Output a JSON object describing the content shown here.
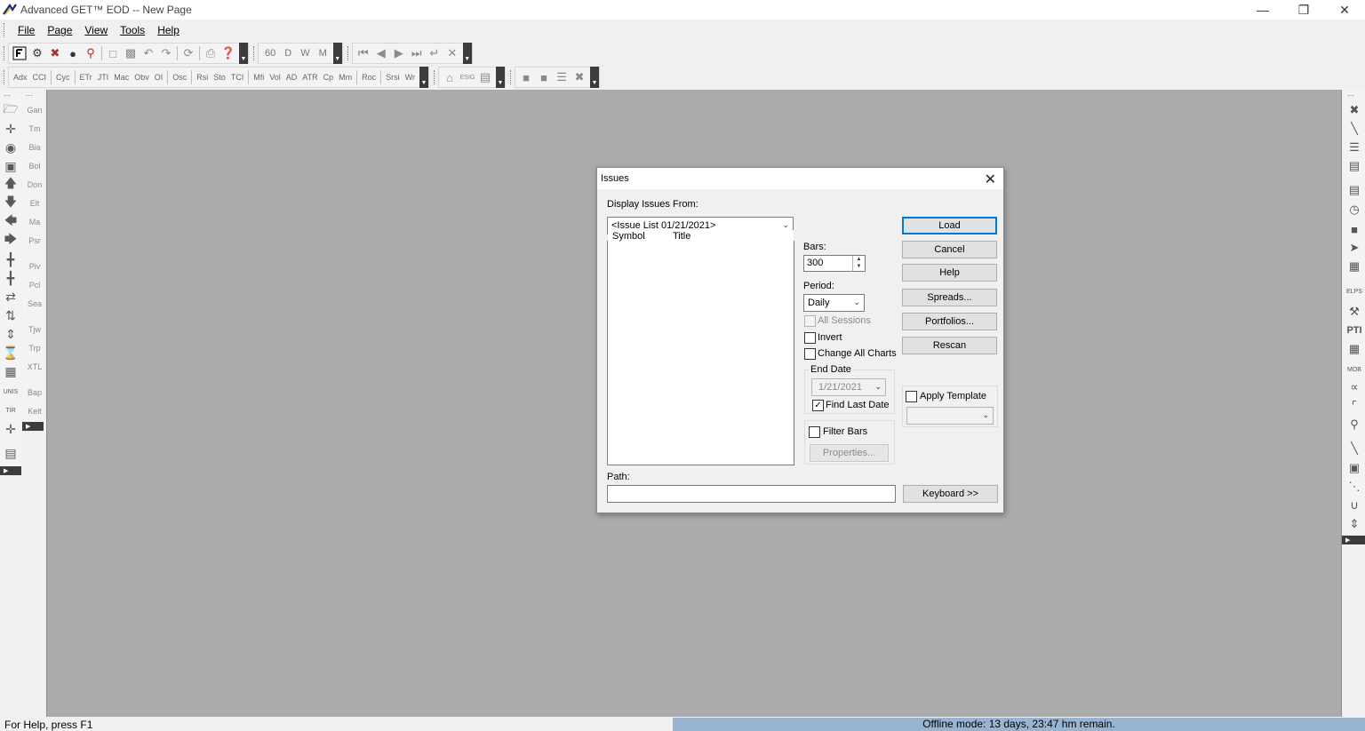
{
  "window": {
    "title": "Advanced GET™ EOD  --  New Page",
    "minimize": "—",
    "restore": "❐",
    "close": "✕"
  },
  "menu": {
    "file": "File",
    "page": "Page",
    "view": "View",
    "tools": "Tools",
    "help": "Help"
  },
  "toolbar1": {
    "period_60": "60",
    "period_d": "D",
    "period_w": "W",
    "period_m": "M"
  },
  "toolbar2": {
    "indicators": [
      "Adx",
      "CCI",
      "Cyc",
      "ETr",
      "JTI",
      "Mac",
      "Obv",
      "OI",
      "Osc",
      "Rsi",
      "Sto",
      "TCI",
      "Mfi",
      "Vol",
      "AD",
      "ATR",
      "Cp",
      "Mm",
      "Roc",
      "Srsi",
      "Wr"
    ],
    "esig_label": "ESIG"
  },
  "left_panel": {
    "labels": [
      "Gan",
      "Tm",
      "Bia",
      "Bol",
      "Don",
      "Elt",
      "Ma",
      "Psr",
      "Piv",
      "Pcl",
      "Sea",
      "Tjw",
      "Trp",
      "XTL",
      "Bap",
      "Kelt"
    ],
    "unis_label": "UNIS",
    "tir_label": "TIR"
  },
  "right_panel": {
    "pti_label": "PTI",
    "mob_label": "MOB",
    "ellps_label": "ELPS"
  },
  "dialog": {
    "title": "Issues",
    "display_issues_from_label": "Display Issues From:",
    "issue_list_value": "<Issue List 01/21/2021>",
    "col_symbol": "Symbol",
    "col_title": "Title",
    "bars_label": "Bars:",
    "bars_value": "300",
    "period_label": "Period:",
    "period_value": "Daily",
    "all_sessions_label": "All Sessions",
    "invert_label": "Invert",
    "change_all_charts_label": "Change All Charts",
    "end_date_label": "End Date",
    "end_date_value": "1/21/2021",
    "find_last_date_label": "Find Last Date",
    "filter_bars_label": "Filter Bars",
    "properties_label": "Properties...",
    "apply_template_label": "Apply Template",
    "path_label": "Path:",
    "buttons": {
      "load": "Load",
      "cancel": "Cancel",
      "help": "Help",
      "spreads": "Spreads...",
      "portfolios": "Portfolios...",
      "rescan": "Rescan",
      "keyboard": "Keyboard >>"
    },
    "find_last_date_checked": true
  },
  "status": {
    "help": "For Help, press F1",
    "offline": "Offline mode: 13 days, 23:47 hm remain."
  },
  "colors": {
    "workspace": "#ababab",
    "offline_bar": "#99b4d1",
    "default_button_border": "#0078d7"
  }
}
